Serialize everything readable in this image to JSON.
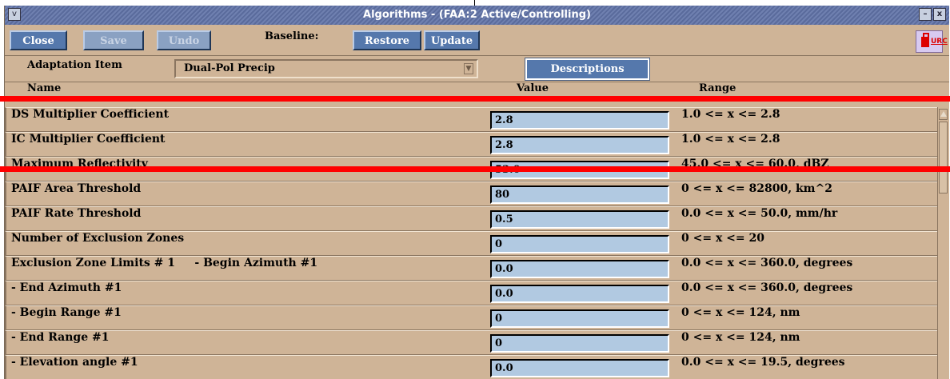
{
  "window": {
    "title": "Algorithms - (FAA:2 Active/Controlling)",
    "sys_menu_glyph": "v",
    "min_glyph": "–",
    "close_glyph": "x"
  },
  "toolbar": {
    "close": "Close",
    "save": "Save",
    "undo": "Undo",
    "baseline_label": "Baseline:",
    "restore": "Restore",
    "update": "Update",
    "urc_label": "URC"
  },
  "adaptation": {
    "label": "Adaptation Item",
    "selected": "Dual-Pol Precip",
    "descriptions_button": "Descriptions"
  },
  "columns": {
    "name": "Name",
    "value": "Value",
    "range": "Range"
  },
  "rows": [
    {
      "name": "DS Multiplier Coefficient",
      "value": "2.8",
      "range": "1.0 <= x <= 2.8"
    },
    {
      "name": "IC Multiplier Coefficient",
      "value": "2.8",
      "range": "1.0 <= x <= 2.8"
    },
    {
      "name": "Maximum Reflectivity",
      "value": "53.0",
      "range": "45.0 <= x <= 60.0, dBZ"
    },
    {
      "name": "PAIF Area Threshold",
      "value": "80",
      "range": "0 <= x <= 82800, km^2"
    },
    {
      "name": "PAIF Rate Threshold",
      "value": "0.5",
      "range": "0.0 <= x <= 50.0, mm/hr"
    },
    {
      "name": "Number of Exclusion Zones",
      "value": "0",
      "range": "0 <= x <= 20"
    },
    {
      "name": "Exclusion Zone Limits # 1     - Begin Azimuth #1",
      "value": "0.0",
      "range": "0.0 <= x <= 360.0, degrees"
    },
    {
      "name": "- End Azimuth #1",
      "value": "0.0",
      "range": "0.0 <= x <= 360.0, degrees"
    },
    {
      "name": "- Begin Range #1",
      "value": "0",
      "range": "0 <= x <= 124, nm"
    },
    {
      "name": "- End Range #1",
      "value": "0",
      "range": "0 <= x <= 124, nm"
    },
    {
      "name": "- Elevation angle #1",
      "value": "0.0",
      "range": "0.0 <= x <= 19.5, degrees"
    }
  ],
  "colors": {
    "panel": "#cfb497",
    "button": "#5578ac",
    "value_field": "#b1c9e1",
    "annotation": "#ff0000"
  }
}
